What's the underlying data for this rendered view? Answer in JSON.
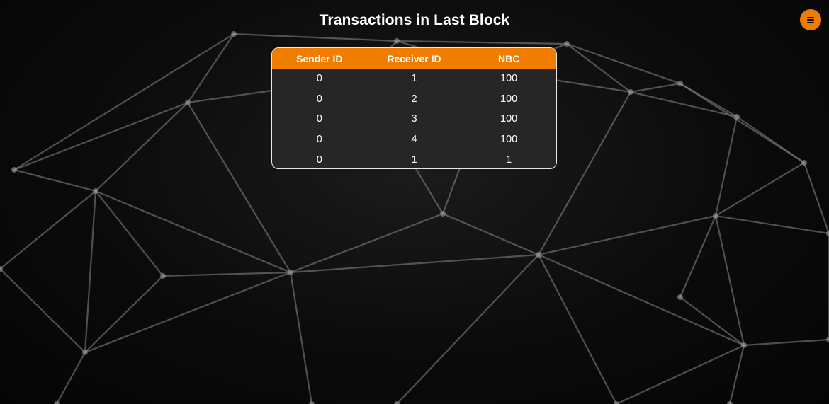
{
  "page": {
    "title": "Transactions in Last Block"
  },
  "menu": {
    "icon": "hamburger-menu-icon",
    "color": "#f07c00"
  },
  "table": {
    "header_color": "#f07c00",
    "columns": [
      "Sender ID",
      "Receiver ID",
      "NBC"
    ],
    "rows": [
      [
        "0",
        "1",
        "100"
      ],
      [
        "0",
        "2",
        "100"
      ],
      [
        "0",
        "3",
        "100"
      ],
      [
        "0",
        "4",
        "100"
      ],
      [
        "0",
        "1",
        "1"
      ]
    ]
  }
}
